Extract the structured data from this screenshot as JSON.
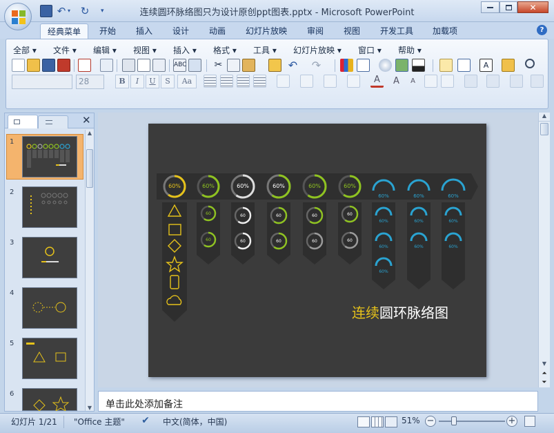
{
  "window": {
    "title": "连续圆环脉络图只为设计原创ppt图表.pptx - Microsoft PowerPoint"
  },
  "tabs": [
    "经典菜单",
    "开始",
    "插入",
    "设计",
    "动画",
    "幻灯片放映",
    "审阅",
    "视图",
    "开发工具",
    "加载项"
  ],
  "menus": [
    "全部",
    "文件",
    "编辑",
    "视图",
    "插入",
    "格式",
    "工具",
    "幻灯片放映",
    "窗口",
    "帮助"
  ],
  "font_size": "28",
  "format_buttons": [
    "B",
    "I",
    "U",
    "S",
    "Aa"
  ],
  "thumbnails": [
    "1",
    "2",
    "3",
    "4",
    "5",
    "6"
  ],
  "slide": {
    "center_value": "60",
    "center_unit": "%",
    "title_highlight": "连续",
    "title_rest": "圆环脉络图"
  },
  "notes_placeholder": "单击此处添加备注",
  "status": {
    "slide_info": "幻灯片 1/21",
    "theme": "\"Office 主题\"",
    "language": "中文(简体，中国)",
    "zoom": "51%"
  },
  "colors": {
    "slide_bg": "#3b3b3b",
    "yellow": "#e6c21a",
    "green": "#8fc320",
    "blue": "#2aa3d1",
    "gray_ring": "#9b9b9b"
  }
}
